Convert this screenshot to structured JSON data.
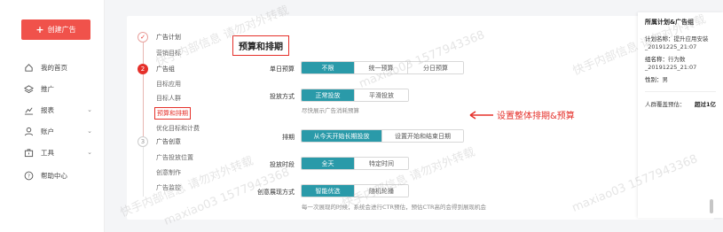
{
  "sidebar": {
    "create_button": "创建广告",
    "items": [
      {
        "label": "我的首页",
        "icon": "home-icon",
        "has_chevron": false
      },
      {
        "label": "推广",
        "icon": "layers-icon",
        "has_chevron": false
      },
      {
        "label": "报表",
        "icon": "chart-icon",
        "has_chevron": true
      },
      {
        "label": "账户",
        "icon": "user-icon",
        "has_chevron": true
      },
      {
        "label": "工具",
        "icon": "toolbox-icon",
        "has_chevron": true
      },
      {
        "label": "帮助中心",
        "icon": "help-icon",
        "has_chevron": false
      }
    ]
  },
  "steps": {
    "s1": {
      "label": "广告计划",
      "subs": [
        "营销目标"
      ]
    },
    "s2": {
      "number": "2",
      "label": "广告组",
      "subs": [
        "目标应用",
        "目标人群",
        "预算和排期",
        "优化目标和计费"
      ]
    },
    "s3": {
      "number": "3",
      "label": "广告创意",
      "subs": [
        "广告投放位置",
        "创意制作",
        "广告监控"
      ]
    }
  },
  "section_title": "预算和排期",
  "form": {
    "daily_budget": {
      "label": "单日预算",
      "options": [
        "不限",
        "统一预算",
        "分日预算"
      ],
      "selected": 0
    },
    "delivery": {
      "label": "投放方式",
      "options": [
        "正常投放",
        "平滑投放"
      ],
      "selected": 0,
      "hint": "尽快展示广告消耗预算"
    },
    "schedule": {
      "label": "排期",
      "options": [
        "从今天开始长期投放",
        "设置开始和结束日期"
      ],
      "selected": 0
    },
    "time_slot": {
      "label": "投放时段",
      "options": [
        "全天",
        "特定时间"
      ],
      "selected": 0
    },
    "display": {
      "label": "创意展现方式",
      "options": [
        "智能优选",
        "随机轮播"
      ],
      "selected": 0,
      "hint": "每一次展现的时候，系统会进行CTR预估，预估CTR高的会得到展现机会"
    }
  },
  "annotation": "设置整体排期&预算",
  "right_panel": {
    "title": "所属计划&广告组",
    "plan_label": "计划名称：",
    "plan_value": "提升应用安装_20191225_21:07",
    "group_label": "组名称：",
    "group_value": "行为数_20191225_21:07",
    "gender_label": "性别：",
    "gender_value": "男",
    "estimate_label": "人群覆盖预估：",
    "estimate_value": "超过1亿"
  },
  "watermark": {
    "text": "快手内部信息 请勿对外转载",
    "id": "maxiao03 1577943368"
  },
  "colors": {
    "brand_red": "#f0524b",
    "accent_teal": "#2a9aa9",
    "annotation_red": "#e5302a"
  }
}
